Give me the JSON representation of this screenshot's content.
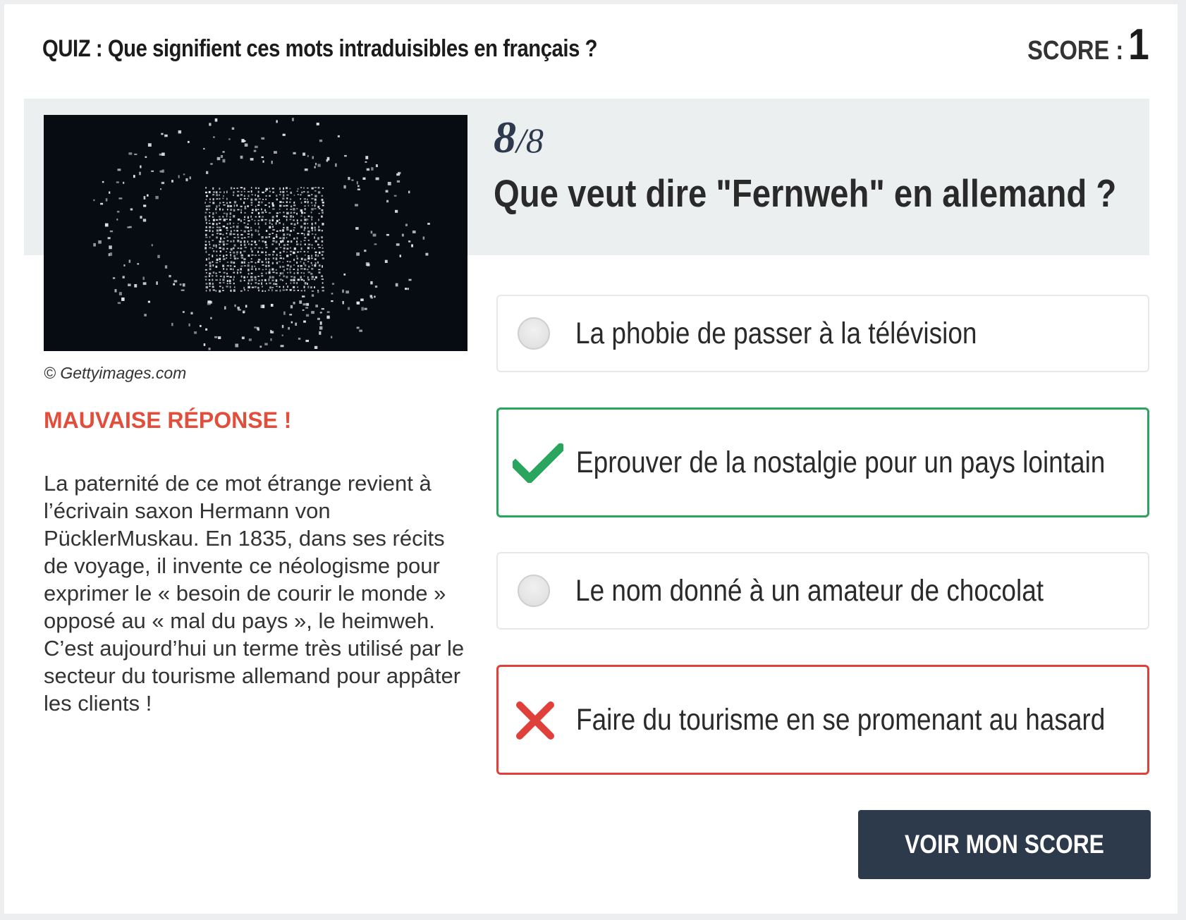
{
  "header": {
    "quiz_title": "QUIZ : Que signifient ces mots intraduisibles en français ?",
    "score_label": "SCORE :",
    "score_value": "1"
  },
  "question": {
    "current": "8",
    "separator": "/",
    "total": "8",
    "text": "Que veut dire \"Fernweh\" en allemand ?"
  },
  "image": {
    "credit": "© Gettyimages.com"
  },
  "feedback": {
    "result": "MAUVAISE RÉPONSE !",
    "explanation": "La paternité de ce mot étrange revient à l’écrivain saxon Hermann von PücklerMuskau. En 1835, dans ses récits de voyage, il invente ce néologisme pour exprimer le « besoin de courir le monde » opposé au « mal du pays », le heimweh. C’est aujourd’hui un terme très utilisé par le secteur du tourisme allemand pour appâter les clients !"
  },
  "answers": [
    {
      "text": "La phobie de passer à la télévision",
      "state": "neutral",
      "icon": "radio-icon"
    },
    {
      "text": "Eprouver de la nostalgie pour un pays lointain",
      "state": "correct",
      "icon": "checkmark-icon"
    },
    {
      "text": "Le nom donné à un amateur de chocolat",
      "state": "neutral",
      "icon": "radio-icon"
    },
    {
      "text": "Faire du tourisme en se promenant au hasard",
      "state": "wrong",
      "icon": "cross-icon"
    }
  ],
  "actions": {
    "see_score": "VOIR MON SCORE"
  },
  "colors": {
    "correct": "#2aa55d",
    "wrong": "#e0403a",
    "result_text": "#e14f3c",
    "button_bg": "#2c3a4b",
    "band_bg": "#eceff0"
  }
}
